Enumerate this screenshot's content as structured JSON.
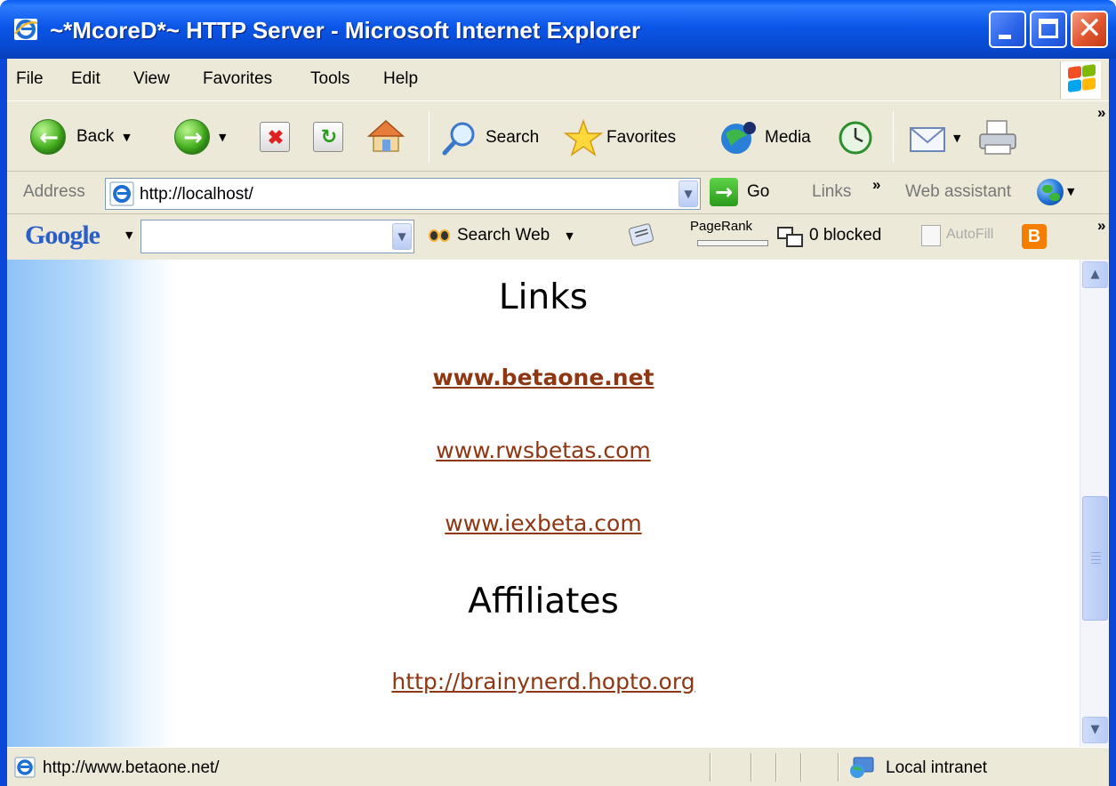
{
  "window": {
    "title": "~*McoreD*~ HTTP Server - Microsoft Internet Explorer"
  },
  "menu": {
    "items": [
      {
        "label": "File"
      },
      {
        "label": "Edit"
      },
      {
        "label": "View"
      },
      {
        "label": "Favorites"
      },
      {
        "label": "Tools"
      },
      {
        "label": "Help"
      }
    ]
  },
  "toolbar": {
    "back_label": "Back",
    "search_label": "Search",
    "favorites_label": "Favorites",
    "media_label": "Media"
  },
  "address_bar": {
    "label": "Address",
    "value": "http://localhost/",
    "go_label": "Go",
    "links_label": "Links",
    "web_assistant_label": "Web assistant"
  },
  "google_bar": {
    "logo": "Google",
    "search_web_label": "Search Web",
    "pagerank_label": "PageRank",
    "blocked_label": "0 blocked",
    "autofill_label": "AutoFill"
  },
  "content": {
    "links_heading": "Links",
    "links": [
      {
        "text": "www.betaone.net"
      },
      {
        "text": "www.rwsbetas.com"
      },
      {
        "text": "www.iexbeta.com"
      }
    ],
    "affiliates_heading": "Affiliates",
    "affiliates": [
      {
        "text": "http://brainynerd.hopto.org"
      }
    ]
  },
  "status_bar": {
    "text": "http://www.betaone.net/",
    "zone": "Local intranet"
  },
  "icons": {
    "back": "back-arrow-icon",
    "forward": "forward-arrow-icon",
    "stop": "stop-icon",
    "refresh": "refresh-icon",
    "home": "home-icon",
    "search": "search-magnifier-icon",
    "favorites": "favorites-star-icon",
    "media": "media-icon",
    "history": "history-icon",
    "mail": "mail-icon",
    "print": "printer-icon"
  },
  "colors": {
    "link": "#8e3712",
    "titlebar": "#0a56e8",
    "chrome": "#ece9d8"
  }
}
